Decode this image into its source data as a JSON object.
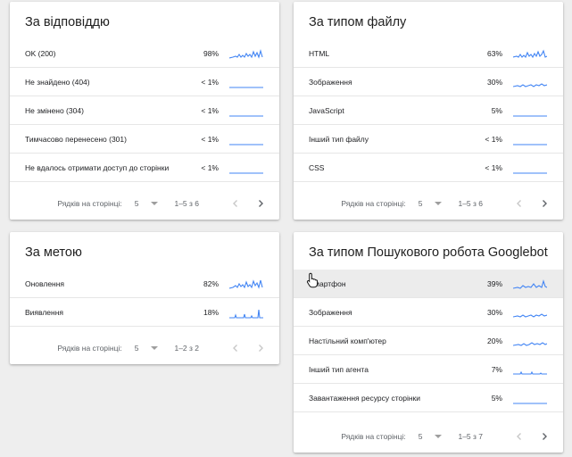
{
  "cards": {
    "status": {
      "title": "За відповіддю",
      "rows": [
        {
          "label": "OK (200)",
          "pct": "98%"
        },
        {
          "label": "Не знайдено (404)",
          "pct": "< 1%"
        },
        {
          "label": "Не змінено (304)",
          "pct": "< 1%"
        },
        {
          "label": "Тимчасово перенесено (301)",
          "pct": "< 1%"
        },
        {
          "label": "Не вдалось отримати доступ до сторінки",
          "pct": "< 1%"
        }
      ],
      "footer": {
        "rows_per_page_label": "Рядків на сторінці:",
        "rows_per_page": "5",
        "range": "1–5 з 6"
      }
    },
    "filetype": {
      "title": "За типом файлу",
      "rows": [
        {
          "label": "HTML",
          "pct": "63%"
        },
        {
          "label": "Зображення",
          "pct": "30%"
        },
        {
          "label": "JavaScript",
          "pct": "5%"
        },
        {
          "label": "Інший тип файлу",
          "pct": "< 1%"
        },
        {
          "label": "CSS",
          "pct": "< 1%"
        }
      ],
      "footer": {
        "rows_per_page_label": "Рядків на сторінці:",
        "rows_per_page": "5",
        "range": "1–5 з 6"
      }
    },
    "purpose": {
      "title": "За метою",
      "rows": [
        {
          "label": "Оновлення",
          "pct": "82%"
        },
        {
          "label": "Виявлення",
          "pct": "18%"
        }
      ],
      "footer": {
        "rows_per_page_label": "Рядків на сторінці:",
        "rows_per_page": "5",
        "range": "1–2 з 2"
      }
    },
    "googlebot": {
      "title": "За типом Пошукового робота Googlebot",
      "rows": [
        {
          "label": "Смартфон",
          "pct": "39%"
        },
        {
          "label": "Зображення",
          "pct": "30%"
        },
        {
          "label": "Настільний комп'ютер",
          "pct": "20%"
        },
        {
          "label": "Інший тип агента",
          "pct": "7%"
        },
        {
          "label": "Завантаження ресурсу сторінки",
          "pct": "5%"
        }
      ],
      "footer": {
        "rows_per_page_label": "Рядків на сторінці:",
        "rows_per_page": "5",
        "range": "1–5 з 7"
      }
    }
  },
  "colors": {
    "sparkline": "#4285f4",
    "highlight_row": "#ececec"
  },
  "icons": {
    "prev": "chevron-left-icon",
    "next": "chevron-right-icon",
    "dropdown": "caret-down-icon",
    "cursor": "hand-pointer-icon"
  }
}
